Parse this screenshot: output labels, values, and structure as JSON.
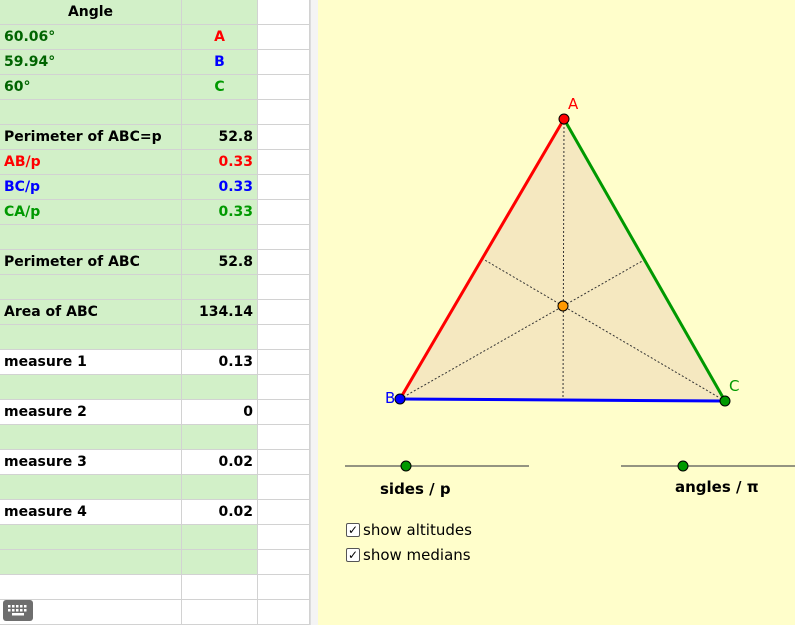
{
  "spreadsheet": {
    "rows": [
      {
        "label": "Angle",
        "value": "",
        "bg": "green",
        "label_color": "#000000",
        "value_color": "#000000",
        "label_align": "center"
      },
      {
        "label": "60.06°",
        "value": "A",
        "bg": "green",
        "label_color": "#006400",
        "value_color": "#ff0000",
        "value_align": "center"
      },
      {
        "label": "59.94°",
        "value": "B",
        "bg": "green",
        "label_color": "#006400",
        "value_color": "#0000ff",
        "value_align": "center"
      },
      {
        "label": "60°",
        "value": "C",
        "bg": "green",
        "label_color": "#006400",
        "value_color": "#009900",
        "value_align": "center"
      },
      {
        "label": "",
        "value": "",
        "bg": "green"
      },
      {
        "label": "Perimeter of ABC=p",
        "value": "52.8",
        "bg": "green",
        "label_color": "#000000",
        "value_color": "#000000"
      },
      {
        "label": "AB/p",
        "value": "0.33",
        "bg": "green",
        "label_color": "#ff0000",
        "value_color": "#ff0000"
      },
      {
        "label": "BC/p",
        "value": "0.33",
        "bg": "green",
        "label_color": "#0000ff",
        "value_color": "#0000ff"
      },
      {
        "label": "CA/p",
        "value": "0.33",
        "bg": "green",
        "label_color": "#009900",
        "value_color": "#009900"
      },
      {
        "label": "",
        "value": "",
        "bg": "green"
      },
      {
        "label": "Perimeter of ABC",
        "value": "52.8",
        "bg": "green",
        "label_color": "#000000",
        "value_color": "#000000"
      },
      {
        "label": "",
        "value": "",
        "bg": "green"
      },
      {
        "label": "Area of ABC",
        "value": "134.14",
        "bg": "green",
        "label_color": "#000000",
        "value_color": "#000000"
      },
      {
        "label": "",
        "value": "",
        "bg": "green"
      },
      {
        "label": "measure 1",
        "value": "0.13",
        "bg": "white",
        "label_color": "#000000",
        "value_color": "#000000"
      },
      {
        "label": "",
        "value": "",
        "bg": "green"
      },
      {
        "label": "measure 2",
        "value": "0",
        "bg": "white",
        "label_color": "#000000",
        "value_color": "#000000"
      },
      {
        "label": "",
        "value": "",
        "bg": "green"
      },
      {
        "label": "measure 3",
        "value": "0.02",
        "bg": "white",
        "label_color": "#000000",
        "value_color": "#000000"
      },
      {
        "label": "",
        "value": "",
        "bg": "green"
      },
      {
        "label": "measure 4",
        "value": "0.02",
        "bg": "white",
        "label_color": "#000000",
        "value_color": "#000000"
      },
      {
        "label": "",
        "value": "",
        "bg": "green"
      },
      {
        "label": "",
        "value": "",
        "bg": "green"
      },
      {
        "label": "",
        "value": "",
        "bg": "white"
      },
      {
        "label": "",
        "value": "",
        "bg": "white"
      }
    ]
  },
  "graphics": {
    "vertex_labels": {
      "A": "A",
      "B": "B",
      "C": "C"
    },
    "colors": {
      "side_AB": "#ff0000",
      "side_BC": "#0000ff",
      "side_CA": "#009900",
      "fill": "#f5e8c0",
      "centroid": "#ff9900",
      "background": "#fffecb"
    },
    "slider_sides_label": "sides / p",
    "slider_angles_label": "angles / π",
    "checkbox_altitudes": {
      "label": "show altitudes",
      "checked": true
    },
    "checkbox_medians": {
      "label": "show medians",
      "checked": true
    }
  },
  "icons": {
    "keyboard": "keyboard-icon",
    "checkmark": "check-icon"
  }
}
